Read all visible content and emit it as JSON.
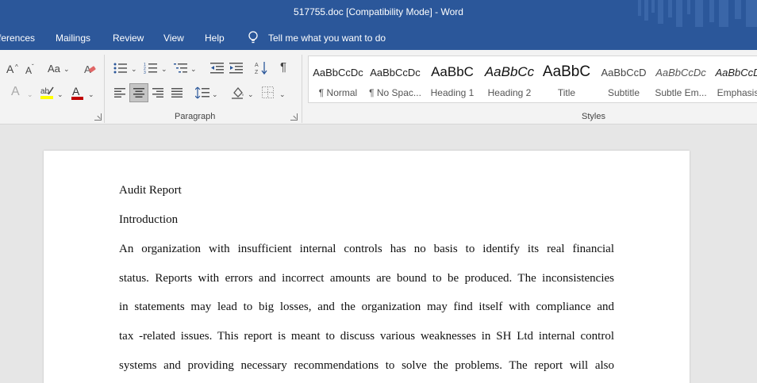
{
  "window": {
    "title": "517755.doc [Compatibility Mode]  -  Word"
  },
  "menu": {
    "tabs": [
      "ferences",
      "Mailings",
      "Review",
      "View",
      "Help"
    ],
    "tell_me": "Tell me what you want to do"
  },
  "ribbon": {
    "font_group": {
      "grow_font": "A",
      "shrink_font": "A",
      "change_case": "Aa",
      "text_effects": "A",
      "highlight": "ab",
      "font_color": "A"
    },
    "paragraph_group": {
      "label": "Paragraph",
      "show_marks": "¶"
    },
    "styles_group": {
      "label": "Styles",
      "items": [
        {
          "sample": "AaBbCcDc",
          "name": "¶ Normal"
        },
        {
          "sample": "AaBbCcDc",
          "name": "¶ No Spac..."
        },
        {
          "sample": "AaBbC",
          "name": "Heading 1"
        },
        {
          "sample": "AaBbCc",
          "name": "Heading 2"
        },
        {
          "sample": "AaBbC",
          "name": "Title"
        },
        {
          "sample": "AaBbCcD",
          "name": "Subtitle"
        },
        {
          "sample": "AaBbCcDc",
          "name": "Subtle Em..."
        },
        {
          "sample": "AaBbCcD",
          "name": "Emphasis"
        }
      ]
    },
    "colors": {
      "highlight": "#ffff00",
      "font_color": "#c00000"
    }
  },
  "document": {
    "heading": "Audit Report",
    "subheading": "Introduction",
    "lines": [
      "An organization with insufficient internal controls has no basis to identify its real financial",
      "status.  Reports with errors and incorrect amounts are bound to be produced. The inconsistencies",
      "in statements may lead to big losses, and the organization may find itself with compliance and",
      "tax -related issues. This report is meant to discuss various weaknesses in SH Ltd internal control",
      "systems and providing necessary recommendations to solve the problems. The report will also"
    ]
  },
  "colors": {
    "accent": "#2b579a",
    "ribbon_bg": "#f3f3f3",
    "canvas_bg": "#e6e6e6"
  }
}
